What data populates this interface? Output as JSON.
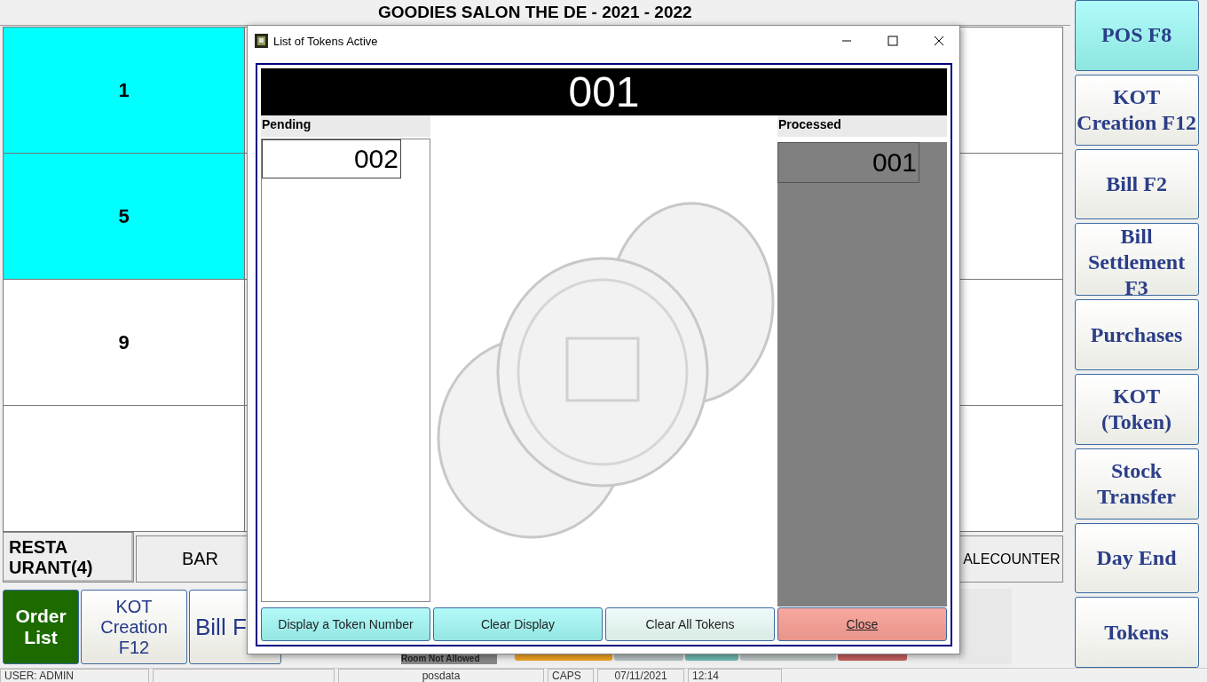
{
  "app_title": "GOODIES SALON THE DE - 2021 - 2022",
  "tables": [
    {
      "label": "1",
      "occupied": true
    },
    {
      "label": "5",
      "occupied": true
    },
    {
      "label": "9",
      "occupied": false
    },
    {
      "occupied": false
    }
  ],
  "section_tabs": [
    {
      "label": "RESTA URANT(4)",
      "selected": true
    },
    {
      "label": "BAR",
      "selected": false
    },
    {
      "label": "ALECOUNTER",
      "selected": false
    }
  ],
  "bottom_buttons": [
    {
      "label": "Order List",
      "kind": "primary"
    },
    {
      "label": "KOT Creation F12",
      "kind": "normal"
    },
    {
      "label": "Bill F",
      "kind": "large"
    }
  ],
  "notice": "Room Not Allowed",
  "side_buttons": [
    {
      "label": "POS F8",
      "selected": true
    },
    {
      "label": "KOT Creation F12",
      "selected": false
    },
    {
      "label": "Bill F2",
      "selected": false
    },
    {
      "label": "Bill Settlement F3",
      "selected": false
    },
    {
      "label": "Purchases",
      "selected": false
    },
    {
      "label": "KOT (Token)",
      "selected": false
    },
    {
      "label": "Stock Transfer",
      "selected": false
    },
    {
      "label": "Day End",
      "selected": false
    },
    {
      "label": "Tokens",
      "selected": false
    }
  ],
  "status_bar": [
    "USER: ADMIN",
    "posdata",
    "CAPS",
    "07/11/2021",
    "12:14"
  ],
  "dialog": {
    "title": "List of Tokens Active",
    "display": "001",
    "pending": {
      "heading": "Pending",
      "items": [
        "002"
      ]
    },
    "processed": {
      "heading": "Processed",
      "items": [
        "001"
      ]
    },
    "buttons": [
      {
        "label": "Display a Token Number",
        "kind": "cyan"
      },
      {
        "label": "Clear Display",
        "kind": "cyan"
      },
      {
        "label": "Clear All Tokens",
        "kind": "light"
      },
      {
        "label": "Close",
        "kind": "danger"
      }
    ]
  }
}
